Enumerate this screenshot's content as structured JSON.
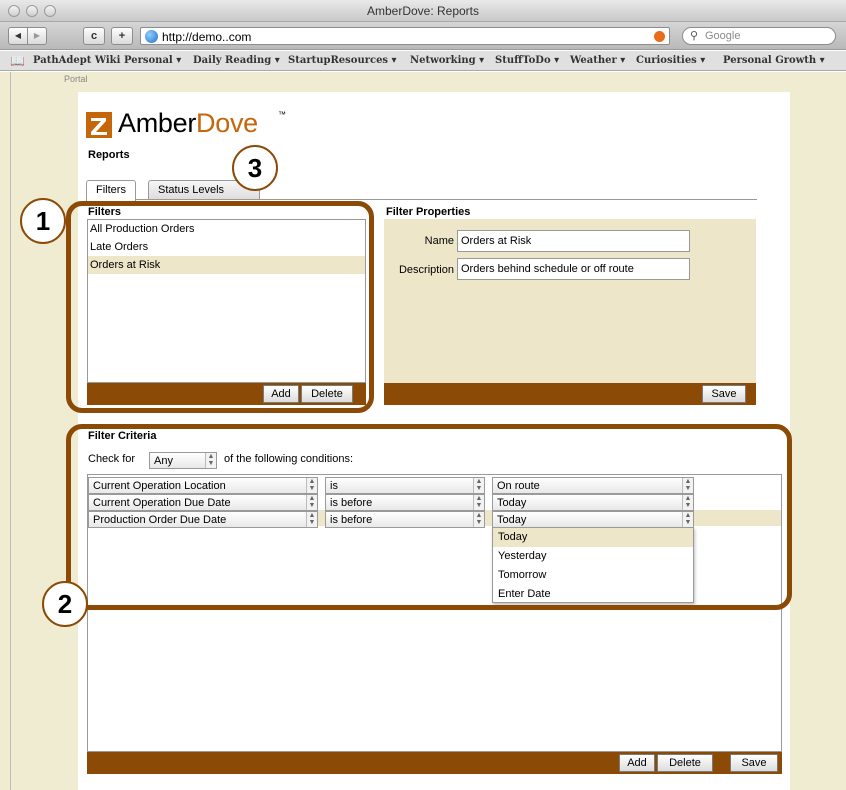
{
  "window": {
    "title": "AmberDove: Reports"
  },
  "toolbar": {
    "back": "◀",
    "forward": "▶",
    "reload": "c",
    "add": "+",
    "url": "http://demo..com",
    "search_placeholder": "Google"
  },
  "bookmarks": [
    {
      "label": "PathAdept Wiki"
    },
    {
      "label": "Personal ▾"
    },
    {
      "label": "Daily Reading ▾"
    },
    {
      "label": "StartupResources ▾"
    },
    {
      "label": "Networking ▾"
    },
    {
      "label": "StuffToDo ▾"
    },
    {
      "label": "Weather ▾"
    },
    {
      "label": "Curiosities ▾"
    },
    {
      "label": "Personal Growth ▾"
    }
  ],
  "page": {
    "portal": "Portal",
    "logo_amber": "Amber",
    "logo_dove": "Dove",
    "logo_tm": "™",
    "heading": "Reports"
  },
  "tabs": [
    {
      "label": "Filters",
      "active": true
    },
    {
      "label": "Status Levels",
      "active": false
    }
  ],
  "filters": {
    "title": "Filters",
    "items": [
      {
        "label": "All Production Orders",
        "selected": false
      },
      {
        "label": "Late Orders",
        "selected": false
      },
      {
        "label": "Orders at Risk",
        "selected": true
      }
    ],
    "add_label": "Add",
    "delete_label": "Delete"
  },
  "properties": {
    "title": "Filter Properties",
    "name_label": "Name",
    "name_value": "Orders at Risk",
    "description_label": "Description",
    "description_value": "Orders behind schedule or off route",
    "save_label": "Save"
  },
  "criteria": {
    "title": "Filter Criteria",
    "check_prefix": "Check for",
    "match_value": "Any",
    "check_suffix": "of the following conditions:",
    "rows": [
      {
        "field": "Current Operation Location",
        "operator": "is",
        "value": "On route"
      },
      {
        "field": "Current Operation Due Date",
        "operator": "is before",
        "value": "Today"
      },
      {
        "field": "Production Order Due Date",
        "operator": "is before",
        "value": "Today"
      }
    ],
    "dropdown_options": [
      {
        "label": "Today",
        "selected": true
      },
      {
        "label": "Yesterday",
        "selected": false
      },
      {
        "label": "Tomorrow",
        "selected": false
      },
      {
        "label": "Enter Date",
        "selected": false
      }
    ],
    "add_label": "Add",
    "delete_label": "Delete",
    "save_label": "Save"
  },
  "callouts": {
    "one": "1",
    "two": "2",
    "three": "3"
  },
  "colors": {
    "accent_brown": "#8b4a06",
    "panel_tan": "#eee6c9",
    "page_bg": "#f0ecd2",
    "logo_orange": "#c5660b"
  }
}
